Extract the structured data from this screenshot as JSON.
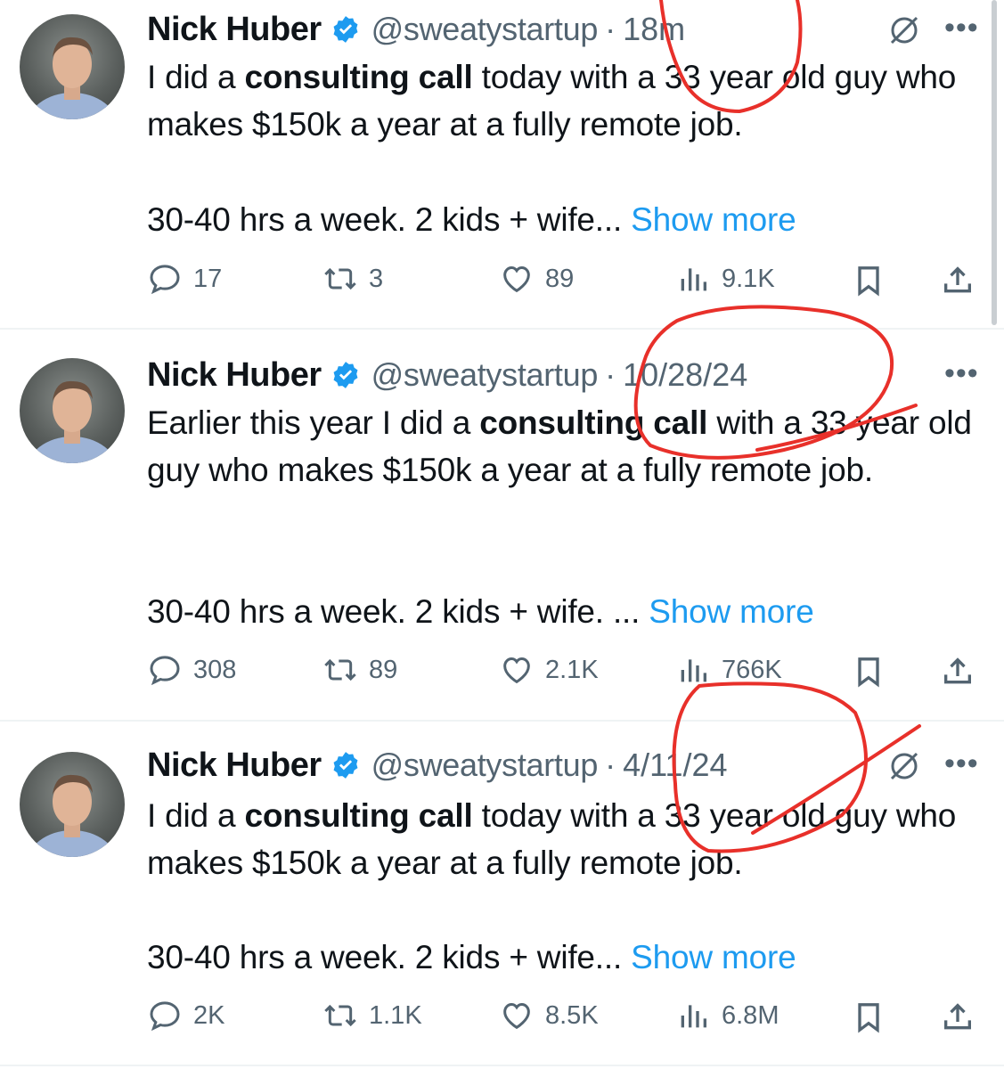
{
  "tweets": [
    {
      "name": "Nick Huber",
      "handle": "@sweatystartup",
      "separator": "·",
      "time": "18m",
      "text_parts": [
        "I did a ",
        "consulting call",
        " today with a 33 year old guy who makes $150k a year at a fully remote job."
      ],
      "text_line2": "30-40 hrs a week. 2 kids + wife...",
      "show_more": "Show more",
      "replies": "17",
      "reposts": "3",
      "likes": "89",
      "views": "9.1K"
    },
    {
      "name": "Nick Huber",
      "handle": "@sweatystartup",
      "separator": "·",
      "time": "10/28/24",
      "text_parts": [
        "Earlier this year I did a ",
        "consulting call",
        " with a 33 year old guy who makes $150k a year at a fully remote job."
      ],
      "text_line2": "30-40 hrs a week. 2 kids + wife. ...",
      "show_more": "Show more",
      "replies": "308",
      "reposts": "89",
      "likes": "2.1K",
      "views": "766K"
    },
    {
      "name": "Nick Huber",
      "handle": "@sweatystartup",
      "separator": "·",
      "time": "4/11/24",
      "text_parts": [
        "I did a ",
        "consulting call",
        " today with a 33 year old guy who makes $150k a year at a fully remote job."
      ],
      "text_line2": "30-40 hrs a week. 2 kids + wife...",
      "show_more": "Show more",
      "replies": "2K",
      "reposts": "1.1K",
      "likes": "8.5K",
      "views": "6.8M"
    }
  ],
  "icons": {
    "verified": "verified-badge-icon",
    "grok": "grok-icon",
    "more": "more-options-icon",
    "reply": "reply-icon",
    "repost": "repost-icon",
    "like": "like-icon",
    "views": "views-icon",
    "bookmark": "bookmark-icon",
    "share": "share-icon"
  },
  "colors": {
    "link": "#1d9bf0",
    "secondary": "#536471",
    "annotation": "#e8302a"
  }
}
